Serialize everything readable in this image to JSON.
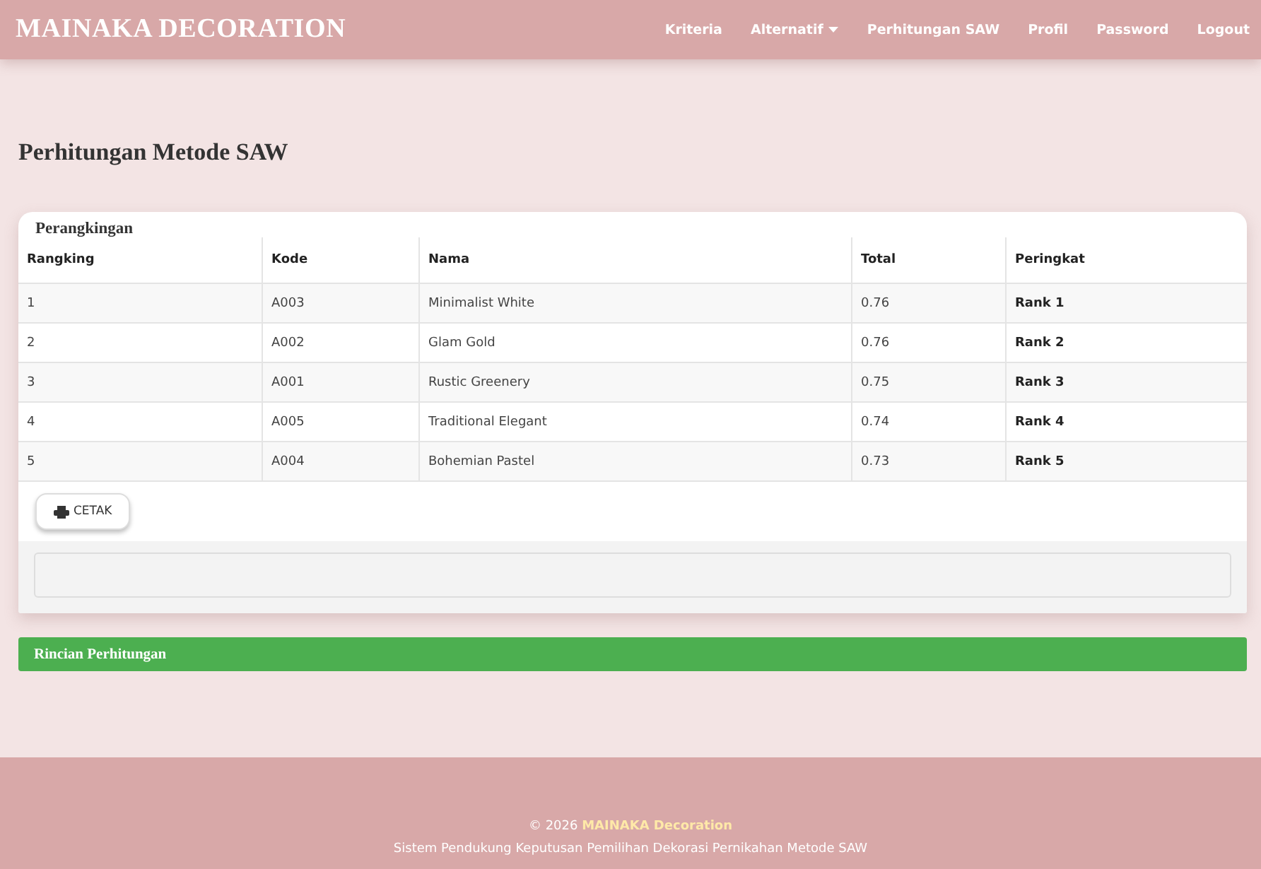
{
  "navbar": {
    "brand": "MAINAKA DECORATION",
    "items": [
      {
        "label": "Kriteria",
        "dropdown": false
      },
      {
        "label": "Alternatif",
        "dropdown": true
      },
      {
        "label": "Perhitungan SAW",
        "dropdown": false
      },
      {
        "label": "Profil",
        "dropdown": false
      },
      {
        "label": "Password",
        "dropdown": false
      },
      {
        "label": "Logout",
        "dropdown": false
      }
    ]
  },
  "page_title": "Perhitungan Metode SAW",
  "ranking_card": {
    "title": "Perangkingan",
    "columns": [
      "Rangking",
      "Kode",
      "Nama",
      "Total",
      "Peringkat"
    ],
    "rows": [
      [
        "1",
        "A003",
        "Minimalist White",
        "0.76",
        "Rank 1"
      ],
      [
        "2",
        "A002",
        "Glam Gold",
        "0.76",
        "Rank 2"
      ],
      [
        "3",
        "A001",
        "Rustic Greenery",
        "0.75",
        "Rank 3"
      ],
      [
        "4",
        "A005",
        "Traditional Elegant",
        "0.74",
        "Rank 4"
      ],
      [
        "5",
        "A004",
        "Bohemian Pastel",
        "0.73",
        "Rank 5"
      ]
    ],
    "print_button": "CETAK"
  },
  "detail_panel": {
    "title": "Rincian Perhitungan"
  },
  "footer": {
    "copyright": "© 2026",
    "brand": "MAINAKA Decoration",
    "tagline": "Sistem Pendukung Keputusan Pemilihan Dekorasi Pernikahan Metode SAW"
  }
}
